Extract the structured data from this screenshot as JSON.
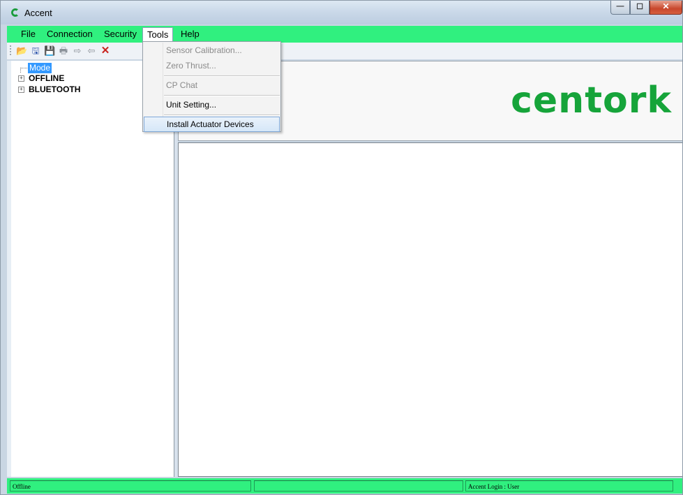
{
  "window": {
    "title": "Accent",
    "minimize_glyph": "—",
    "maximize_glyph": "☐",
    "close_glyph": "✕"
  },
  "menubar": {
    "items": [
      "File",
      "Connection",
      "Security",
      "Tools",
      "Help"
    ],
    "active": "Tools",
    "color": "#30f07f"
  },
  "toolbar": {
    "icons": [
      "open-folder-icon",
      "save-as-icon",
      "save-icon",
      "print-icon",
      "forward-arrow-icon",
      "back-arrow-icon",
      "delete-icon"
    ],
    "glyphs": [
      "📂",
      "🖫",
      "💾",
      "🖶",
      "⇨",
      "⇦",
      "✕"
    ]
  },
  "tree": {
    "root": "Mode",
    "children": [
      "OFFLINE",
      "BLUETOOTH"
    ],
    "expander_glyph": "+"
  },
  "tools_menu": {
    "items": [
      {
        "label": "Sensor Calibration...",
        "enabled": false
      },
      {
        "label": "Zero Thrust...",
        "enabled": false
      },
      {
        "label": "CP Chat",
        "enabled": false
      },
      {
        "label": "Unit Setting...",
        "enabled": true
      },
      {
        "label": "Install Actuator Devices",
        "enabled": true,
        "highlighted": true
      }
    ]
  },
  "logo": {
    "text": "centork",
    "color": "#16a43a"
  },
  "statusbar": {
    "panes": [
      "Offline",
      "",
      "Accent Login : User"
    ]
  }
}
